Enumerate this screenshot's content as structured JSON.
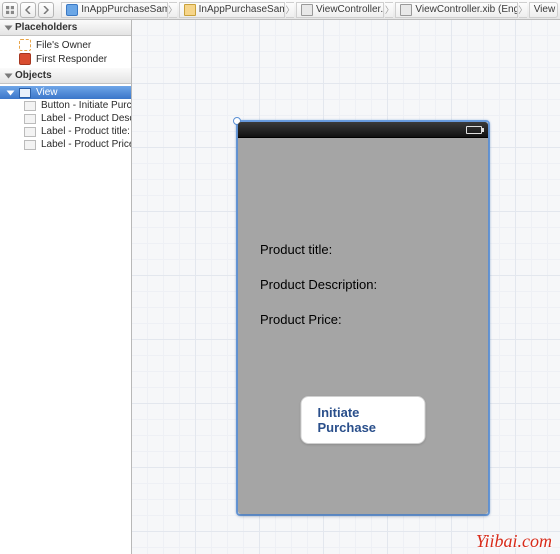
{
  "toolbar": {
    "breadcrumb": [
      {
        "icon": "project",
        "label": "InAppPurchaseSample"
      },
      {
        "icon": "folder",
        "label": "InAppPurchaseSample"
      },
      {
        "icon": "xib",
        "label": "ViewController.xib"
      },
      {
        "icon": "xib",
        "label": "ViewController.xib (English)"
      },
      {
        "icon": "view",
        "label": "View"
      }
    ]
  },
  "sidebar": {
    "placeholders": {
      "title": "Placeholders",
      "items": [
        {
          "label": "File's Owner"
        },
        {
          "label": "First Responder"
        }
      ]
    },
    "objects": {
      "title": "Objects",
      "root": {
        "label": "View",
        "selected": true
      },
      "children": [
        {
          "label": "Button - Initiate Purc…"
        },
        {
          "label": "Label - Product Descr…"
        },
        {
          "label": "Label - Product title:"
        },
        {
          "label": "Label - Product Price:"
        }
      ]
    }
  },
  "canvas": {
    "labels": {
      "title": "Product title:",
      "description": "Product Description:",
      "price": "Product Price:"
    },
    "button": "Initiate Purchase"
  },
  "watermark": "Yiibai.com"
}
